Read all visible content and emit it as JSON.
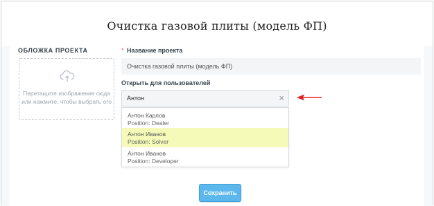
{
  "page": {
    "title": "Очистка газовой плиты (модель ФП)"
  },
  "cover": {
    "label": "ОБЛОЖКА ПРОЕКТА",
    "drop_text_1": "Перетащите изображение сюда",
    "drop_text_2": "или нажмите, чтобы выбрать его",
    "icon": "cloud-upload-icon"
  },
  "form": {
    "required_mark": "*",
    "name_label": "Название проекта",
    "name_value": "Очистка газовой плиты (модель ФП)",
    "open_label": "Открыть для пользователей",
    "select_value": "Антон",
    "clear_icon": "×"
  },
  "dropdown": {
    "options": [
      {
        "name": "Антон Карлов",
        "position": "Position: Dealer",
        "selected": false
      },
      {
        "name": "Антон Иванов",
        "position": "Position: Solver",
        "selected": true
      },
      {
        "name": "Антон Иванов",
        "position": "Position: Developer",
        "selected": false
      }
    ]
  },
  "actions": {
    "save_label": "Сохранить"
  },
  "colors": {
    "accent": "#5cb7ec",
    "highlight": "#f5fab8",
    "arrow": "#e02020",
    "required": "#d9534f"
  }
}
